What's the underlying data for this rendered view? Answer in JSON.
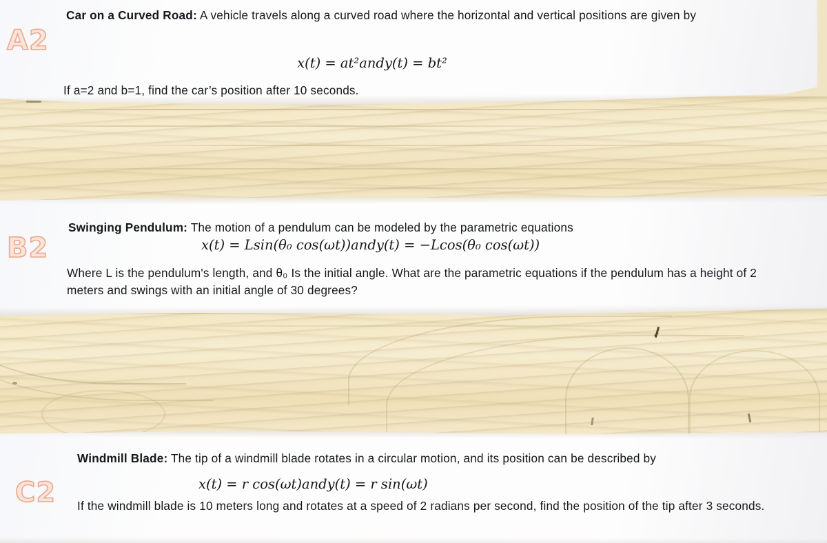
{
  "document": {
    "kind": "photographed-worksheet-strips",
    "surface": "wood",
    "problems": [
      {
        "code": "A2",
        "title": "Car on a Curved Road:",
        "intro": " A vehicle travels along a curved road where the horizontal and vertical positions are given by",
        "equation": {
          "x": "x(t) = at²",
          "and": "and",
          "y": "y(t) = bt²"
        },
        "closing": "If a=2 and b=1, find the car’s position after 10 seconds."
      },
      {
        "code": "B2",
        "title": "Swinging Pendulum:",
        "intro": " The motion of a pendulum can be modeled by the parametric equations",
        "equation": {
          "x": "x(t) = Lsin(θ₀ cos(ωt))",
          "and": "and",
          "y": "y(t) = −Lcos(θ₀ cos(ωt))"
        },
        "closing": "Where L is the pendulum's length, and θ₀ Is the initial angle. What are the parametric equations if the pendulum has a height of 2 meters and swings with an initial angle of 30 degrees?"
      },
      {
        "code": "C2",
        "title": "Windmill Blade:",
        "intro": " The tip of a windmill blade rotates in a circular motion, and its position can be described by",
        "equation": {
          "x": "x(t) = r cos(ωt)",
          "and": "and",
          "y": "y(t) = r sin(ωt)"
        },
        "closing": "If the windmill blade is 10 meters long and rotates at a speed of 2 radians per second, find the position of the tip after 3 seconds."
      }
    ]
  },
  "colors": {
    "paper": "#fdfdfd",
    "wood": "#f2e6c2",
    "wood_grain": "#a88c5c",
    "label_fill": "#fae3d8",
    "label_stroke": "#e9a98e",
    "ink": "#16181c"
  }
}
